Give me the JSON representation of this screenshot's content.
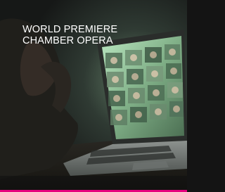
{
  "headline": {
    "line1": "WORLD PREMIERE",
    "line2": "CHAMBER OPERA"
  },
  "colors": {
    "accent": "#e6007e",
    "text": "#ffffff",
    "screen_glow": "#9fd0a6"
  }
}
